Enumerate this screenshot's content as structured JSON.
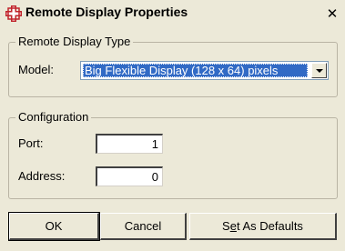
{
  "window": {
    "title": "Remote Display Properties",
    "icon": "remote-display-icon",
    "close_glyph": "✕"
  },
  "remote_display_type": {
    "group_label": "Remote Display Type",
    "model_label": "Model:",
    "model_value": "Big Flexible Display (128 x 64) pixels"
  },
  "configuration": {
    "group_label": "Configuration",
    "port_label": "Port:",
    "port_value": "1",
    "address_label": "Address:",
    "address_value": "0"
  },
  "buttons": {
    "ok": "OK",
    "cancel": "Cancel",
    "defaults_prefix": "S",
    "defaults_underlined": "e",
    "defaults_suffix": "t As Defaults"
  },
  "colors": {
    "window_bg": "#ece9d8",
    "selection": "#316ac5",
    "icon_red": "#c0242b"
  }
}
